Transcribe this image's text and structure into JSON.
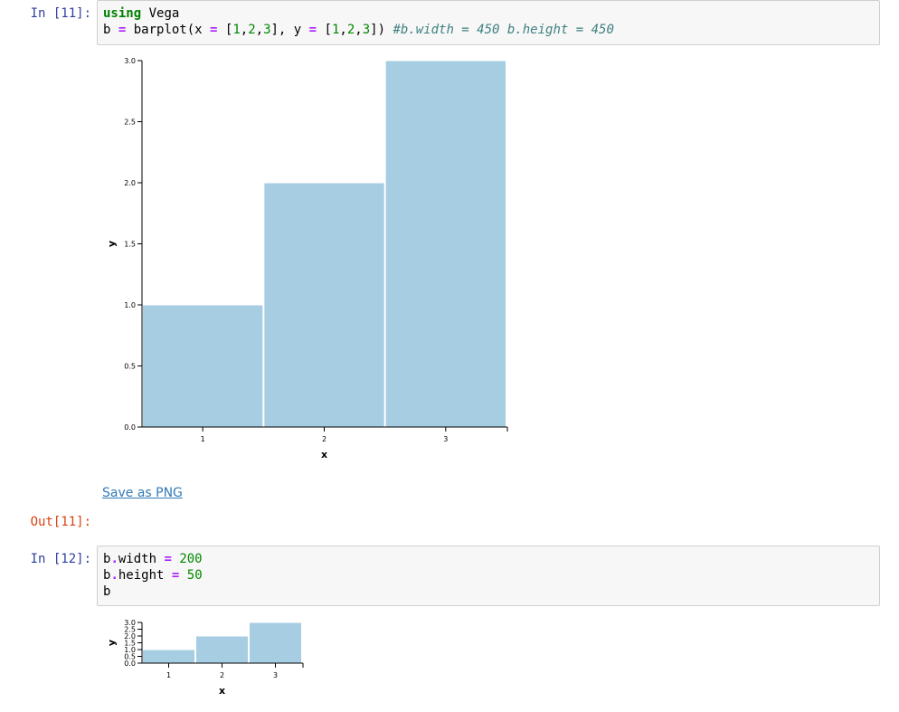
{
  "cells": [
    {
      "prompt": "In [11]:",
      "code": [
        [
          {
            "t": "using",
            "c": "kw"
          },
          {
            "t": " Vega",
            "c": ""
          }
        ],
        [
          {
            "t": "b ",
            "c": ""
          },
          {
            "t": "=",
            "c": "op"
          },
          {
            "t": " barplot(x ",
            "c": ""
          },
          {
            "t": "=",
            "c": "op"
          },
          {
            "t": " [",
            "c": ""
          },
          {
            "t": "1",
            "c": "num"
          },
          {
            "t": ",",
            "c": ""
          },
          {
            "t": "2",
            "c": "num"
          },
          {
            "t": ",",
            "c": ""
          },
          {
            "t": "3",
            "c": "num"
          },
          {
            "t": "], y ",
            "c": ""
          },
          {
            "t": "=",
            "c": "op"
          },
          {
            "t": " [",
            "c": ""
          },
          {
            "t": "1",
            "c": "num"
          },
          {
            "t": ",",
            "c": ""
          },
          {
            "t": "2",
            "c": "num"
          },
          {
            "t": ",",
            "c": ""
          },
          {
            "t": "3",
            "c": "num"
          },
          {
            "t": "]) ",
            "c": ""
          },
          {
            "t": "#b.width = 450 b.height = 450",
            "c": "cmt"
          }
        ]
      ],
      "save_link": "Save as PNG",
      "out_prompt": "Out[11]:"
    },
    {
      "prompt": "In [12]:",
      "code": [
        [
          {
            "t": "b",
            "c": ""
          },
          {
            "t": ".",
            "c": "op"
          },
          {
            "t": "width ",
            "c": ""
          },
          {
            "t": "=",
            "c": "op"
          },
          {
            "t": " ",
            "c": ""
          },
          {
            "t": "200",
            "c": "num"
          }
        ],
        [
          {
            "t": "b",
            "c": ""
          },
          {
            "t": ".",
            "c": "op"
          },
          {
            "t": "height ",
            "c": ""
          },
          {
            "t": "=",
            "c": "op"
          },
          {
            "t": " ",
            "c": ""
          },
          {
            "t": "50",
            "c": "num"
          }
        ],
        [
          {
            "t": "b",
            "c": ""
          }
        ]
      ]
    }
  ],
  "chart_data": [
    {
      "type": "bar",
      "categories": [
        "1",
        "2",
        "3"
      ],
      "values": [
        1,
        2,
        3
      ],
      "xlabel": "x",
      "ylabel": "y",
      "ylim": [
        0,
        3
      ],
      "yticks": [
        "0.0",
        "0.5",
        "1.0",
        "1.5",
        "2.0",
        "2.5",
        "3.0"
      ],
      "bar_color": "#a6cde2",
      "grid": false
    },
    {
      "type": "bar",
      "categories": [
        "1",
        "2",
        "3"
      ],
      "values": [
        1,
        2,
        3
      ],
      "xlabel": "x",
      "ylabel": "y",
      "ylim": [
        0,
        3
      ],
      "yticks": [
        "0.0",
        "0.5",
        "1.0",
        "1.5",
        "2.0",
        "2.5",
        "3.0"
      ],
      "bar_color": "#a6cde2",
      "grid": false
    }
  ]
}
